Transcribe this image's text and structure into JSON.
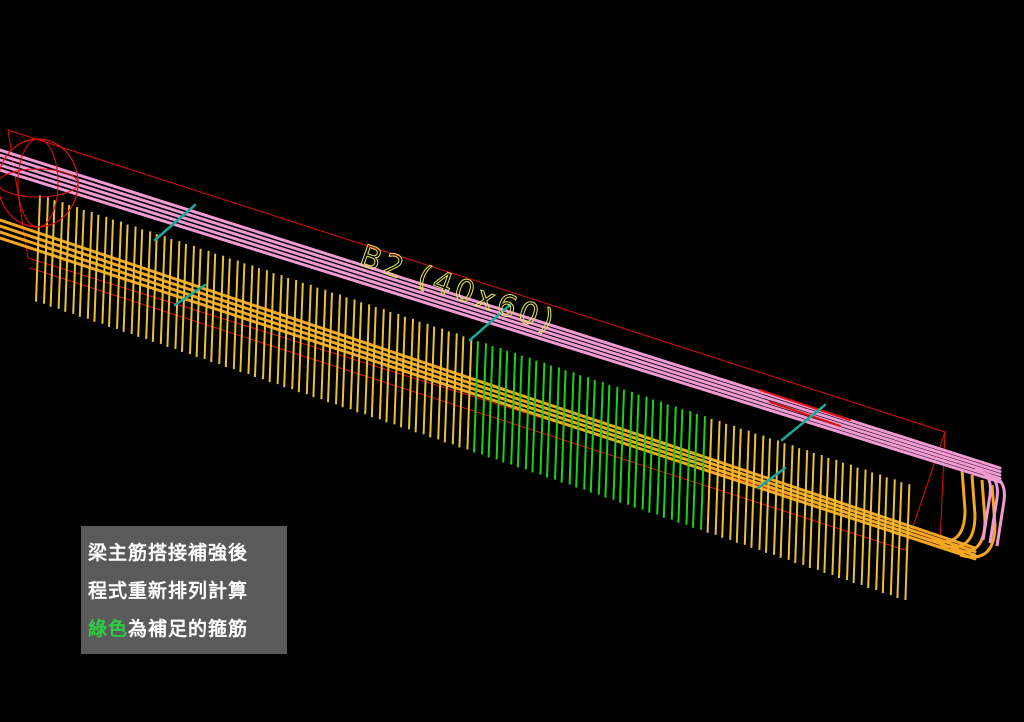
{
  "beam_label": "B2 (40x60)",
  "caption": {
    "line1": "梁主筋搭接補強後",
    "line2": "程式重新排列計算",
    "line3_highlight": "綠色",
    "line3_rest": "為補足的箍筋"
  },
  "colors": {
    "background": "#000000",
    "top_bars": "#f29ad4",
    "bottom_bars": "#f5a623",
    "stirrups": "#e8c23a",
    "added_stirrups": "#19d219",
    "outline": "#e01010",
    "dimension_ticks": "#1aa89a",
    "label": "#e6e65a",
    "caption_bg": "#5a5a5a",
    "caption_text": "#ffffff",
    "caption_highlight": "#2ecc40"
  }
}
